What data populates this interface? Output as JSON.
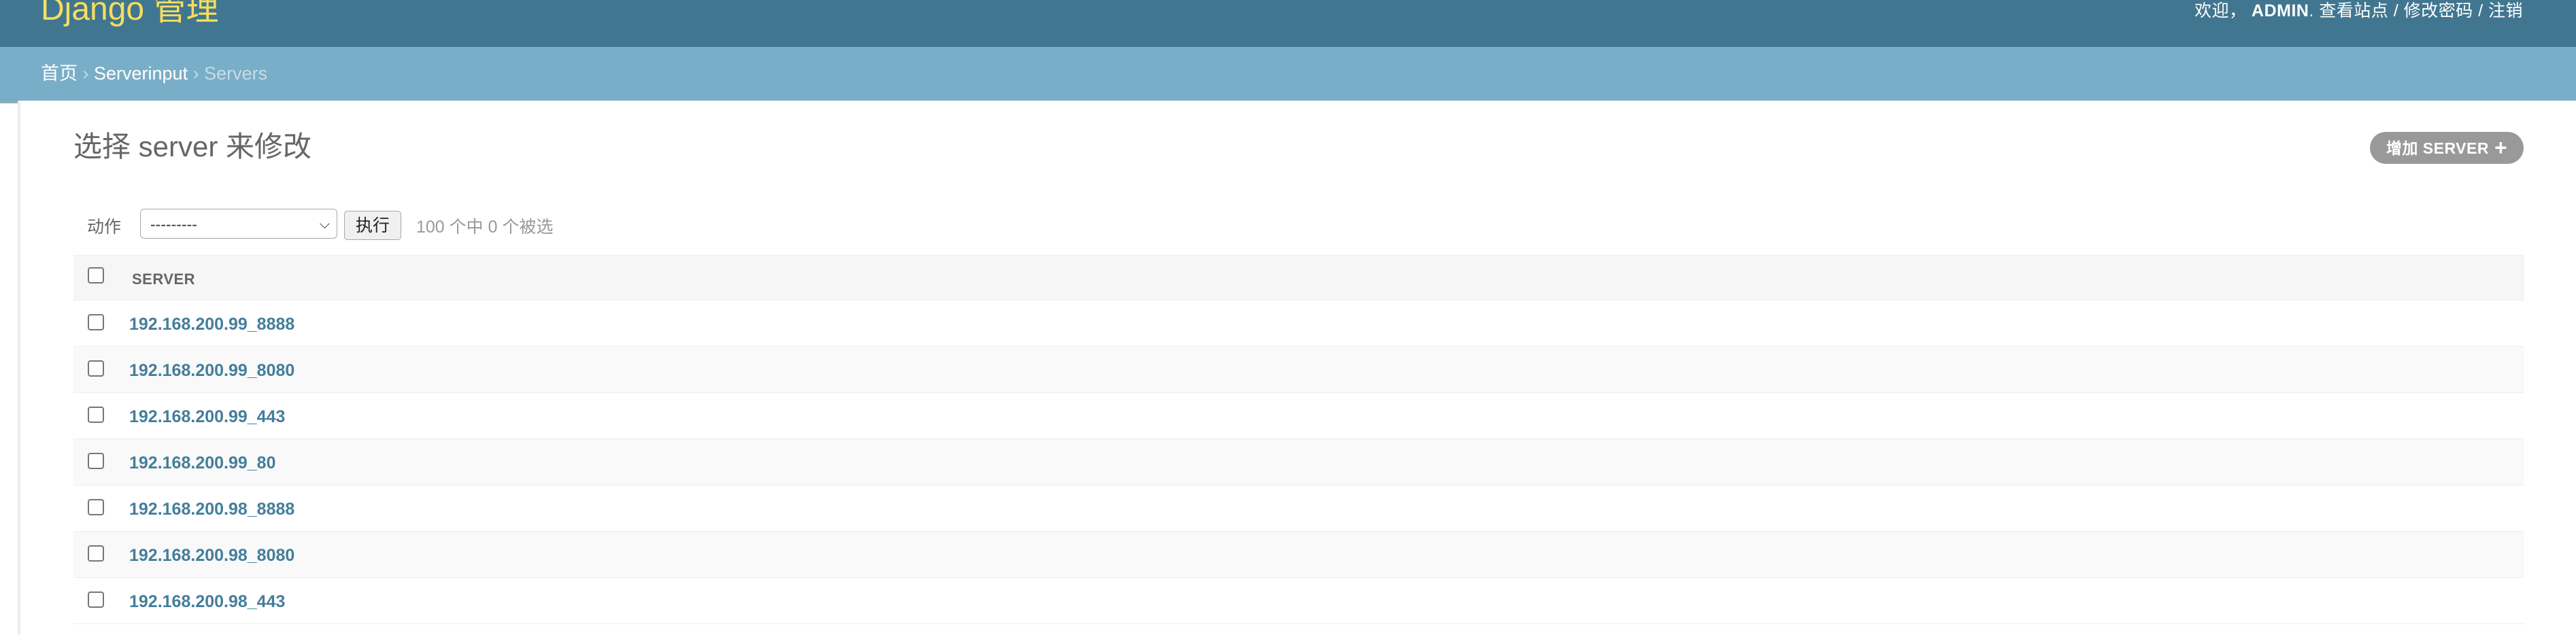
{
  "header": {
    "branding": "Django 管理",
    "welcome": "欢迎，",
    "user": "ADMIN",
    "sep_dot": ".",
    "view_site": "查看站点",
    "slash1": " / ",
    "change_password": "修改密码",
    "slash2": " / ",
    "logout": "注销"
  },
  "breadcrumbs": {
    "home": "首页",
    "sep1": " › ",
    "app": "Serverinput",
    "sep2": " › ",
    "current": "Servers"
  },
  "content": {
    "title": "选择 server 来修改",
    "add_label": "增加 SERVER",
    "add_icon": "+"
  },
  "actions": {
    "label": "动作",
    "select_value": "---------",
    "go_label": "执行",
    "counter": "100 个中 0 个被选"
  },
  "table": {
    "column_header": "SERVER",
    "rows": [
      "192.168.200.99_8888",
      "192.168.200.99_8080",
      "192.168.200.99_443",
      "192.168.200.99_80",
      "192.168.200.98_8888",
      "192.168.200.98_8080",
      "192.168.200.98_443"
    ]
  }
}
